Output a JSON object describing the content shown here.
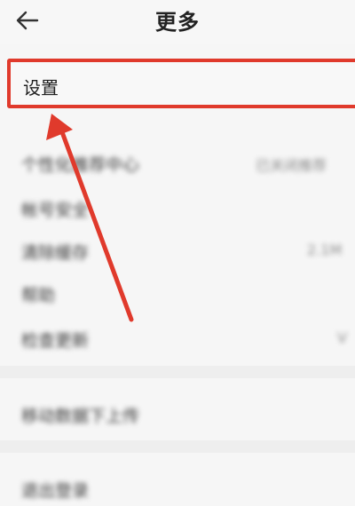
{
  "header": {
    "title": "更多",
    "back_icon": "back-arrow-icon"
  },
  "menu": {
    "settings_label": "设置",
    "blurred_items": [
      {
        "label": "个性化推荐中心",
        "value": "已关闭推荐"
      },
      {
        "label": "帐号安全",
        "value": ""
      },
      {
        "label": "清除缓存",
        "value": "2.1M"
      },
      {
        "label": "帮助",
        "value": ""
      },
      {
        "label": "检查更新",
        "value": "V"
      },
      {
        "label": "移动数据下上传",
        "value": ""
      },
      {
        "label": "退出登录",
        "value": ""
      }
    ]
  },
  "annotation": {
    "highlight_color": "#e03a2c",
    "arrow_color": "#e03a2c"
  }
}
